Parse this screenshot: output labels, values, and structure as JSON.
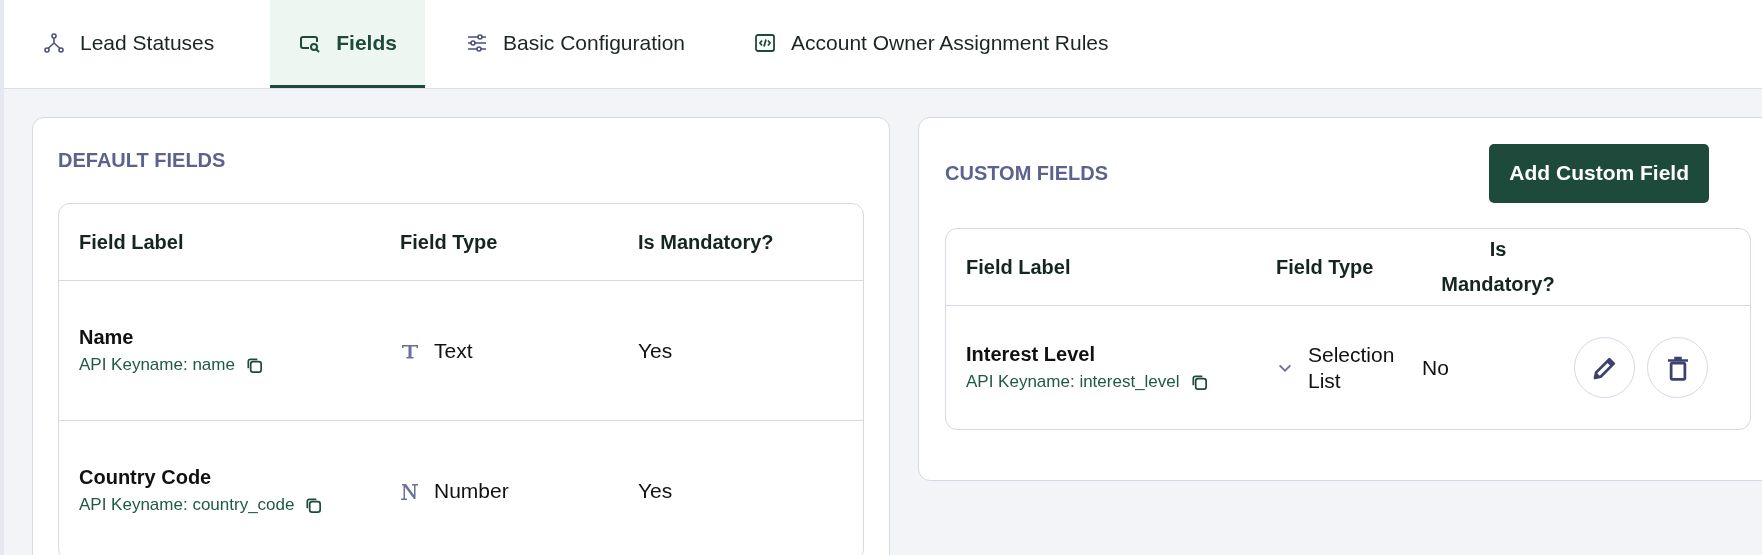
{
  "tabs": [
    {
      "label": "Lead Statuses",
      "selected": false
    },
    {
      "label": "Fields",
      "selected": true
    },
    {
      "label": "Basic Configuration",
      "selected": false
    },
    {
      "label": "Account Owner Assignment Rules",
      "selected": false
    }
  ],
  "default_fields": {
    "title": "DEFAULT FIELDS",
    "columns": [
      "Field Label",
      "Field Type",
      "Is Mandatory?"
    ],
    "rows": [
      {
        "label": "Name",
        "api_keyname": "API Keyname: name",
        "type": "Text",
        "kind": "text",
        "mandatory": "Yes"
      },
      {
        "label": "Country Code",
        "api_keyname": "API Keyname: country_code",
        "type": "Number",
        "kind": "number",
        "mandatory": "Yes"
      }
    ]
  },
  "custom_fields": {
    "title": "CUSTOM FIELDS",
    "add_button": "Add Custom Field",
    "columns": [
      "Field Label",
      "Field Type",
      "Is Mandatory?"
    ],
    "rows": [
      {
        "label": "Interest Level",
        "api_keyname": "API Keyname: interest_level",
        "type": "Selection List",
        "kind": "selection",
        "mandatory": "No"
      }
    ]
  }
}
